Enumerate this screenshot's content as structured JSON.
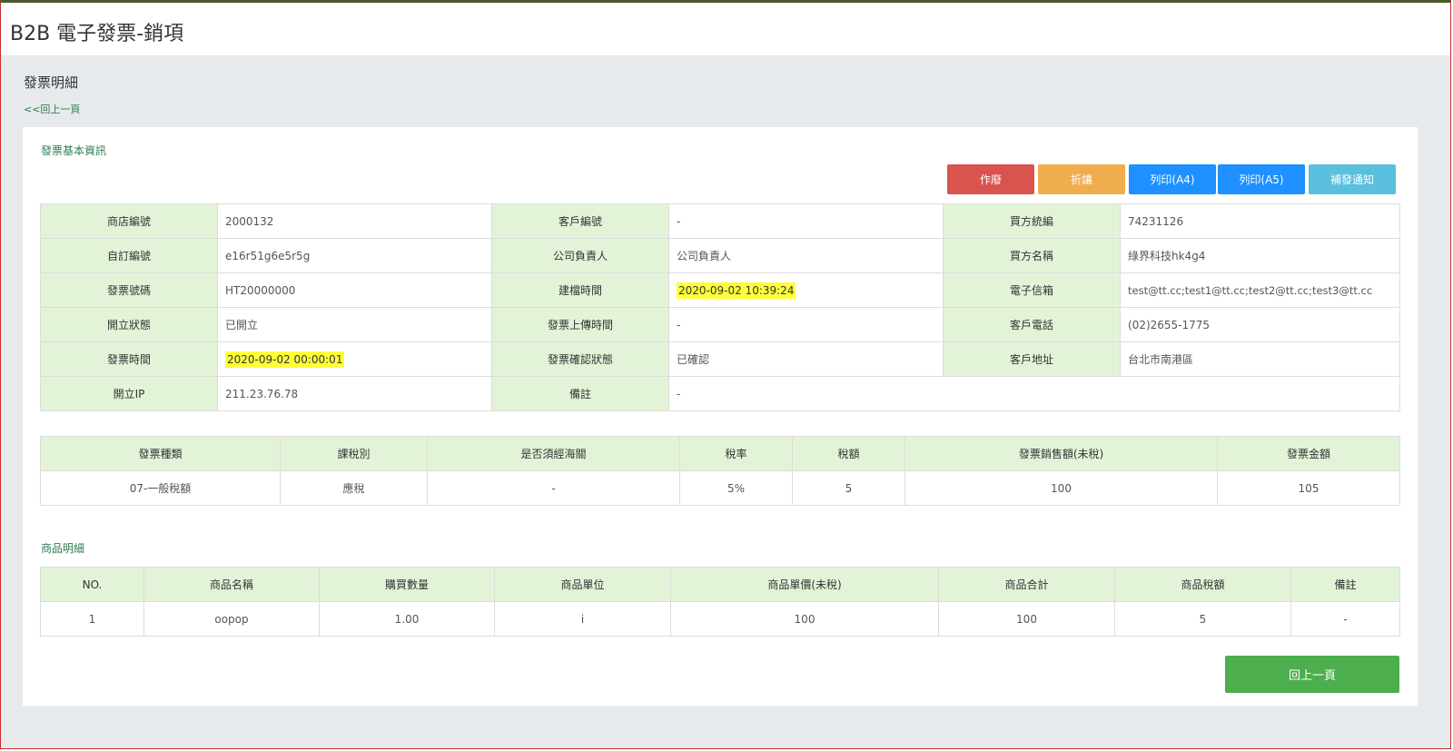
{
  "app": {
    "title": "B2B 電子發票-銷項"
  },
  "page": {
    "title": "發票明細",
    "back_link": "<<回上一頁"
  },
  "sections": {
    "basic_info": "發票基本資訊",
    "items": "商品明細"
  },
  "actions": {
    "void": "作廢",
    "discount": "折讓",
    "print_a4": "列印(A4)",
    "print_a5": "列印(A5)",
    "resend_notice": "補發通知",
    "back": "回上一頁"
  },
  "colors": {
    "void": "#d9534f",
    "discount": "#f0ad4e",
    "print": "#1e90ff",
    "notice": "#5bc0de",
    "back": "#4cae4c",
    "label_bg": "#e3f3d8",
    "highlight": "#ffff3a"
  },
  "info": {
    "rows": [
      {
        "l1": "商店編號",
        "v1": "2000132",
        "l2": "客戶編號",
        "v2": "-",
        "l3": "買方統編",
        "v3": "74231126"
      },
      {
        "l1": "自訂編號",
        "v1": "e16r51g6e5r5g",
        "l2": "公司負責人",
        "v2": "公司負責人",
        "l3": "買方名稱",
        "v3": "綠界科技hk4g4"
      },
      {
        "l1": "發票號碼",
        "v1": "HT20000000",
        "l2": "建檔時間",
        "v2": "2020-09-02 10:39:24",
        "l3": "電子信箱",
        "v3": "test@tt.cc;test1@tt.cc;test2@tt.cc;test3@tt.cc"
      },
      {
        "l1": "開立狀態",
        "v1": "已開立",
        "l2": "發票上傳時間",
        "v2": "-",
        "l3": "客戶電話",
        "v3": "(02)2655-1775"
      },
      {
        "l1": "發票時間",
        "v1": "2020-09-02 00:00:01",
        "l2": "發票確認狀態",
        "v2": "已確認",
        "l3": "客戶地址",
        "v3": "台北市南港區"
      },
      {
        "l1": "開立IP",
        "v1": "211.23.76.78",
        "l2": "備註",
        "v2": "-",
        "l3": "",
        "v3": ""
      }
    ]
  },
  "tax": {
    "headers": [
      "發票種類",
      "課稅別",
      "是否須經海關",
      "稅率",
      "稅額",
      "發票銷售額(未稅)",
      "發票金額"
    ],
    "row": [
      "07-一般稅額",
      "應稅",
      "-",
      "5%",
      "5",
      "100",
      "105"
    ]
  },
  "products": {
    "headers": [
      "NO.",
      "商品名稱",
      "購買數量",
      "商品單位",
      "商品單價(未稅)",
      "商品合計",
      "商品稅額",
      "備註"
    ],
    "rows": [
      [
        "1",
        "oopop",
        "1.00",
        "i",
        "100",
        "100",
        "5",
        "-"
      ]
    ]
  }
}
